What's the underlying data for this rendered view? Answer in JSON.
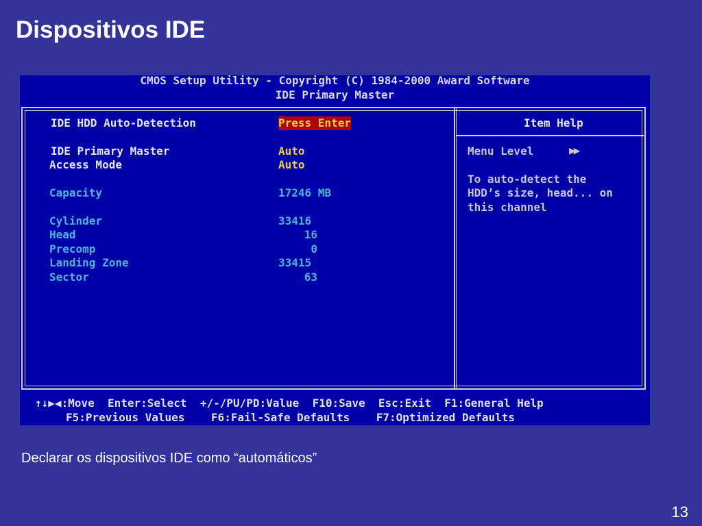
{
  "slide": {
    "title": "Dispositivos IDE",
    "caption": "Declarar os dispositivos IDE como “automáticos”",
    "page_number": "13"
  },
  "bios": {
    "header_line1": "CMOS Setup Utility - Copyright (C) 1984-2000 Award Software",
    "header_line2": "IDE Primary Master",
    "items": [
      {
        "label": "IDE HDD Auto-Detection",
        "value": "Press Enter"
      },
      {
        "label": "IDE Primary Master",
        "value": "Auto"
      },
      {
        "label": "Access Mode",
        "value": "Auto"
      },
      {
        "label": "Capacity",
        "value": "17246 MB"
      },
      {
        "label": "Cylinder",
        "value": "33416"
      },
      {
        "label": "Head",
        "value": "16"
      },
      {
        "label": "Precomp",
        "value": "0"
      },
      {
        "label": "Landing Zone",
        "value": "33415"
      },
      {
        "label": "Sector",
        "value": "63"
      }
    ],
    "help": {
      "title": "Item Help",
      "menu_level_label": "Menu Level",
      "menu_level_arrows": "▶▶",
      "text_line1": "To auto-detect the",
      "text_line2": "HDD’s size, head... on",
      "text_line3": "this channel"
    },
    "footer": {
      "line1": "↑↓▶◀:Move  Enter:Select  +/-/PU/PD:Value  F10:Save  Esc:Exit  F1:General Help",
      "line2": "F5:Previous Values    F6:Fail-Safe Defaults    F7:Optimized Defaults"
    },
    "colors": {
      "background": "#0000a8",
      "label_white": "#e6e6e6",
      "label_cyan": "#49b6d4",
      "value_yellow": "#f5d23c",
      "highlight": "#b00000"
    }
  }
}
